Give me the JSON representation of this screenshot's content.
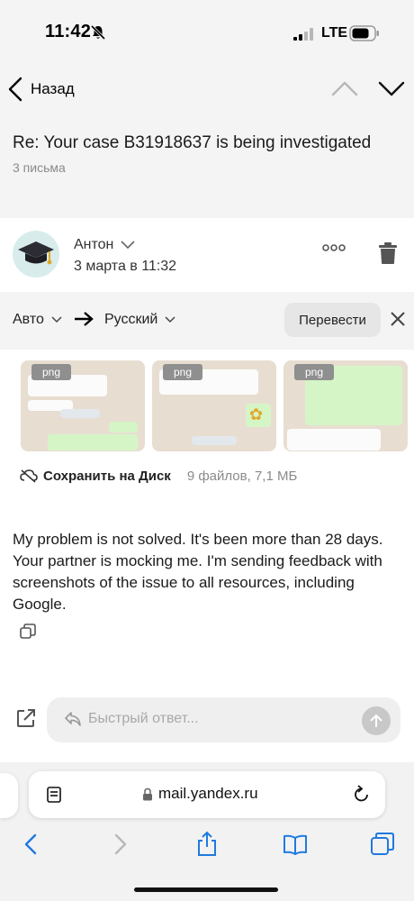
{
  "status_bar": {
    "time": "11:42",
    "network": "LTE",
    "icons": [
      "bell-slash-icon",
      "cellular-signal-icon",
      "battery-icon"
    ]
  },
  "nav": {
    "back_label": "Назад",
    "icons": [
      "chevron-left-icon",
      "chevron-up-icon",
      "chevron-down-icon"
    ]
  },
  "message": {
    "subject": "Re: Your case B31918637 is being investigated",
    "thread_count": "3 письма",
    "sender_name": "Антон",
    "date": "3 марта в 11:32",
    "body": "My problem is not solved. It's been more than 28 days. Your partner is mocking me. I'm sending feedback with screenshots of the issue to all resources, including Google."
  },
  "translate": {
    "from_lang": "Авто",
    "to_lang": "Русский",
    "button_label": "Перевести"
  },
  "attachments": {
    "items": [
      {
        "format": "png"
      },
      {
        "format": "png"
      },
      {
        "format": "png"
      }
    ],
    "save_label": "Сохранить на Диск",
    "files_info": "9 файлов, 7,1 МБ"
  },
  "quick_reply": {
    "placeholder": "Быстрый ответ..."
  },
  "browser": {
    "url": "mail.yandex.ru"
  },
  "colors": {
    "header_bg": "#f4f4f4",
    "accent_blue": "#1f7ae0",
    "muted_text": "#8a8a8a"
  }
}
